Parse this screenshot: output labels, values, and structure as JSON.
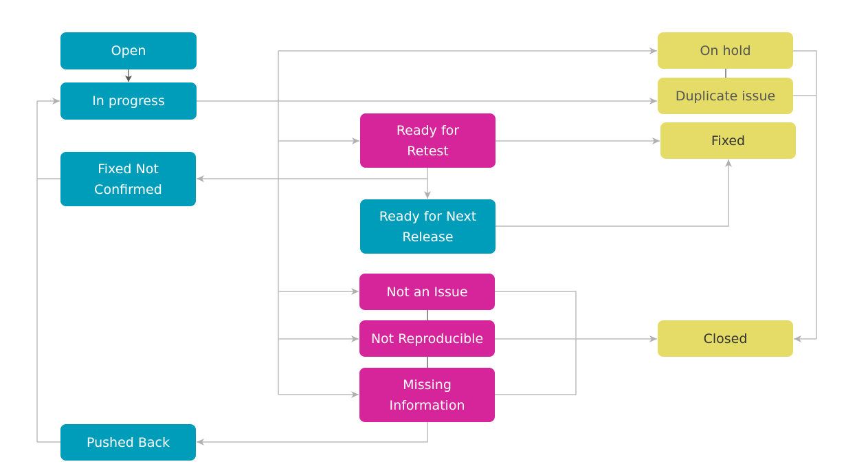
{
  "colors": {
    "teal": "#009dbb",
    "magenta": "#d6259a",
    "yellow": "#e5dc68",
    "edge": "#bbbbbb",
    "edge_dark": "#555555"
  },
  "nodes": [
    {
      "id": "open",
      "label": "Open",
      "color": "teal"
    },
    {
      "id": "in-progress",
      "label": "In progress",
      "color": "teal"
    },
    {
      "id": "fixed-not-confirmed",
      "label": "Fixed Not Confirmed",
      "color": "teal"
    },
    {
      "id": "pushed-back",
      "label": "Pushed Back",
      "color": "teal"
    },
    {
      "id": "ready-for-retest",
      "label": "Ready for Retest",
      "color": "magenta"
    },
    {
      "id": "ready-for-next-release",
      "label": "Ready for Next Release",
      "color": "teal"
    },
    {
      "id": "not-an-issue",
      "label": "Not an Issue",
      "color": "magenta"
    },
    {
      "id": "not-reproducible",
      "label": "Not Reproducible",
      "color": "magenta"
    },
    {
      "id": "missing-information",
      "label": "Missing Information",
      "color": "magenta"
    },
    {
      "id": "on-hold",
      "label": "On hold",
      "color": "yellow"
    },
    {
      "id": "duplicate-issue",
      "label": "Duplicate issue",
      "color": "yellow"
    },
    {
      "id": "fixed",
      "label": "Fixed",
      "color": "yellow"
    },
    {
      "id": "closed",
      "label": "Closed",
      "color": "yellow"
    }
  ],
  "edges": [
    [
      "open",
      "in-progress"
    ],
    [
      "in-progress",
      "on-hold"
    ],
    [
      "in-progress",
      "duplicate-issue"
    ],
    [
      "in-progress",
      "ready-for-retest"
    ],
    [
      "in-progress",
      "not-an-issue"
    ],
    [
      "in-progress",
      "not-reproducible"
    ],
    [
      "in-progress",
      "missing-information"
    ],
    [
      "ready-for-retest",
      "fixed"
    ],
    [
      "ready-for-retest",
      "ready-for-next-release"
    ],
    [
      "ready-for-retest",
      "fixed-not-confirmed"
    ],
    [
      "ready-for-next-release",
      "fixed"
    ],
    [
      "fixed-not-confirmed",
      "in-progress"
    ],
    [
      "pushed-back",
      "in-progress"
    ],
    [
      "missing-information",
      "pushed-back"
    ],
    [
      "not-an-issue",
      "closed"
    ],
    [
      "not-reproducible",
      "closed"
    ],
    [
      "missing-information",
      "closed"
    ],
    [
      "on-hold",
      "closed"
    ],
    [
      "duplicate-issue",
      "closed"
    ]
  ]
}
